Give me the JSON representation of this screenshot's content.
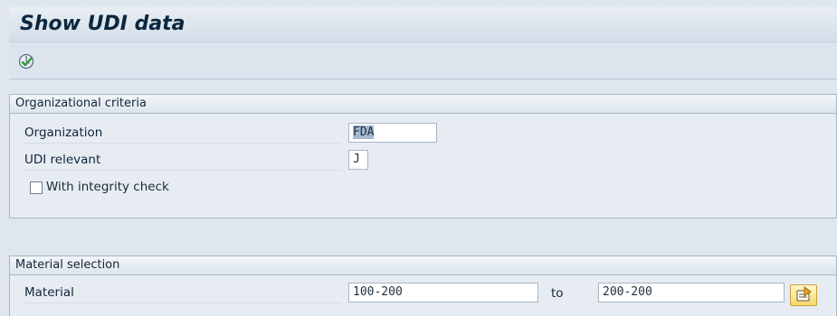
{
  "header": {
    "title": "Show UDI data"
  },
  "toolbar": {
    "execute_icon": "execute-icon"
  },
  "org_group": {
    "title": "Organizational criteria",
    "organization": {
      "label": "Organization",
      "value": "FDA"
    },
    "udi_relevant": {
      "label": "UDI relevant",
      "value": "J"
    },
    "integrity_check": {
      "label": "With integrity check",
      "checked": false
    }
  },
  "material_group": {
    "title": "Material selection",
    "material": {
      "label": "Material",
      "from": "100-200",
      "to_label": "to",
      "to": "200-200"
    },
    "multiple_selection_icon": "multiple-selection-icon"
  },
  "colors": {
    "accent_yellow": "#f5d970",
    "title_color": "#0b2740"
  }
}
